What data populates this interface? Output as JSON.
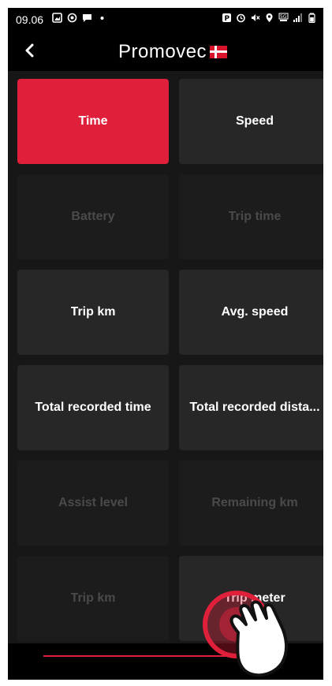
{
  "status_bar": {
    "time": "09.06",
    "left_icons": [
      "image-icon",
      "cast-icon",
      "chat-icon",
      "dot-icon"
    ],
    "right_icons": [
      "parking-icon",
      "alarm-icon",
      "mute-icon",
      "location-icon",
      "5g-icon",
      "signal-icon",
      "battery-icon"
    ]
  },
  "app_bar": {
    "back_icon": "chevron-left-icon",
    "logo_text": "Promovec",
    "logo_flag_icon": "denmark-flag-icon"
  },
  "tiles": [
    {
      "label": "Time",
      "state": "active"
    },
    {
      "label": "Speed",
      "state": "normal"
    },
    {
      "label": "Battery",
      "state": "disabled"
    },
    {
      "label": "Trip time",
      "state": "disabled"
    },
    {
      "label": "Trip km",
      "state": "normal"
    },
    {
      "label": "Avg. speed",
      "state": "normal"
    },
    {
      "label": "Total recorded time",
      "state": "normal"
    },
    {
      "label": "Total recorded dista...",
      "state": "normal"
    },
    {
      "label": "Assist level",
      "state": "disabled"
    },
    {
      "label": "Remaining km",
      "state": "disabled"
    },
    {
      "label": "Trip km",
      "state": "disabled"
    },
    {
      "label": "Trip meter",
      "state": "normal"
    }
  ],
  "bottom_indicator": {
    "progress_fraction": 0.82,
    "color": "#e0203a"
  },
  "colors": {
    "accent": "#e0203a",
    "background": "#171717",
    "tile": "#272727",
    "tile_disabled": "#1c1c1c",
    "text_disabled": "#4a4a4a"
  },
  "overlay": {
    "icon": "tap-gesture-hand-icon"
  }
}
